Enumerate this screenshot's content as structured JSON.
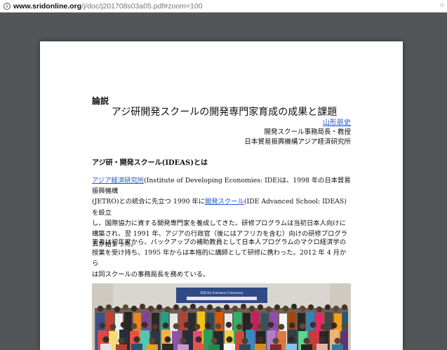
{
  "browser": {
    "url_host": "www.sridonline.org",
    "url_path": "/j/doc/j201708s03a05.pdf#zoom=100"
  },
  "document": {
    "kicker": "論説",
    "title": "アジ研開発スクールの開発専門家育成の成果と課題",
    "author": "山形辰史",
    "affiliation_1": "開発スクール事務局長・教授",
    "affiliation_2": "日本貿易振興機構アジア経済研究所",
    "section_heading": "アジ研・開発スクール(IDEAS)とは",
    "paragraph_1": {
      "line1_link": "アジア経済研究所",
      "line1_text": "(Institute of Developing Economies: IDE)は、1998 年の日本貿易振興機構",
      "line2_text_a": "(JETRO)との統合に先立つ 1990 年に",
      "line2_link": "開発スクール",
      "line2_text_b": "(IDE Advanced School: IDEAS)を設立",
      "line3": "し、国際協力に資する開発専門家を養成してきた。研修プログラムは当初日本人向けに",
      "line4": "構築され、翌 1991 年、アジアの行政官（後にはアフリカを含む）向けの研修プログラ",
      "line5": "ムが始まった。"
    },
    "paragraph_2": {
      "line1": "筆者は初年度から、バックアップの補助教員として日本人プログラムのマクロ経済学の",
      "line2": "授業を受け持ち、1995 年からは本格的に講師として研修に携わった。2012 年 4 月から",
      "line3": "は同スクールの事務局長を務めている。"
    },
    "photo_banner": "IDEAS Entrance Ceremony"
  },
  "colors": {
    "viewer_bg": "#525659",
    "link": "#2255cc"
  }
}
